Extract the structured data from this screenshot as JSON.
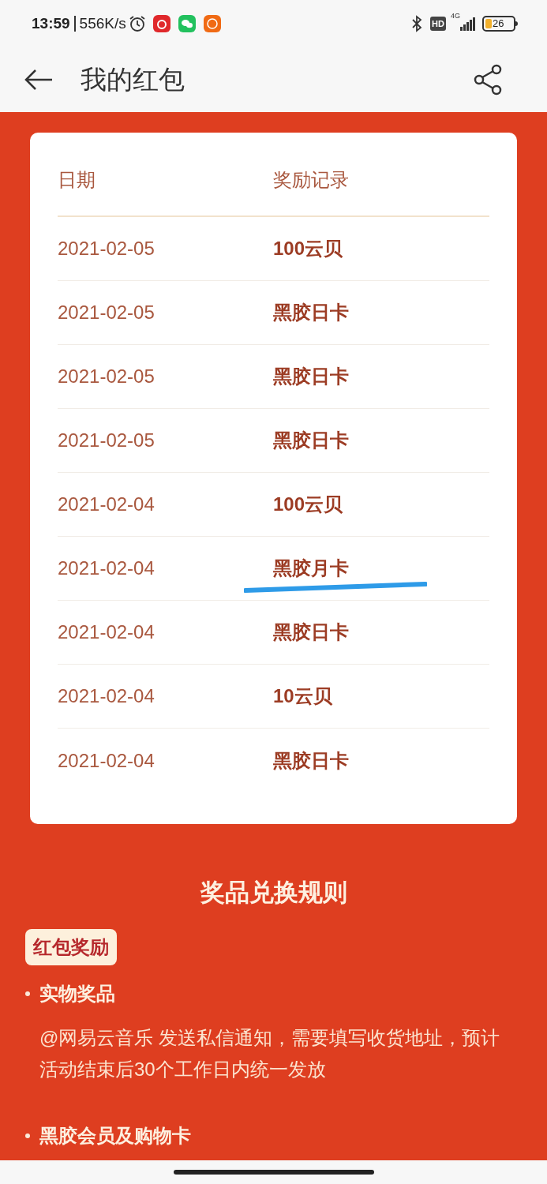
{
  "status_bar": {
    "time": "13:59",
    "speed": "556K/s",
    "network": "4G",
    "hd": "HD",
    "battery": "26"
  },
  "header": {
    "title": "我的红包"
  },
  "table": {
    "columns": [
      "日期",
      "奖励记录"
    ],
    "rows": [
      {
        "date": "2021-02-05",
        "reward": "100云贝",
        "annotated": false
      },
      {
        "date": "2021-02-05",
        "reward": "黑胶日卡",
        "annotated": false
      },
      {
        "date": "2021-02-05",
        "reward": "黑胶日卡",
        "annotated": false
      },
      {
        "date": "2021-02-05",
        "reward": "黑胶日卡",
        "annotated": false
      },
      {
        "date": "2021-02-04",
        "reward": "100云贝",
        "annotated": false
      },
      {
        "date": "2021-02-04",
        "reward": "黑胶月卡",
        "annotated": true
      },
      {
        "date": "2021-02-04",
        "reward": "黑胶日卡",
        "annotated": false
      },
      {
        "date": "2021-02-04",
        "reward": "10云贝",
        "annotated": false
      },
      {
        "date": "2021-02-04",
        "reward": "黑胶日卡",
        "annotated": false
      }
    ]
  },
  "rules": {
    "title": "奖品兑换规则",
    "tag": "红包奖励",
    "items": [
      {
        "heading": "实物奖品",
        "text": "@网易云音乐 发送私信通知，需要填写收货地址，预计活动结束后30个工作日内统一发放"
      },
      {
        "heading": "黑胶会员及购物卡"
      }
    ]
  }
}
